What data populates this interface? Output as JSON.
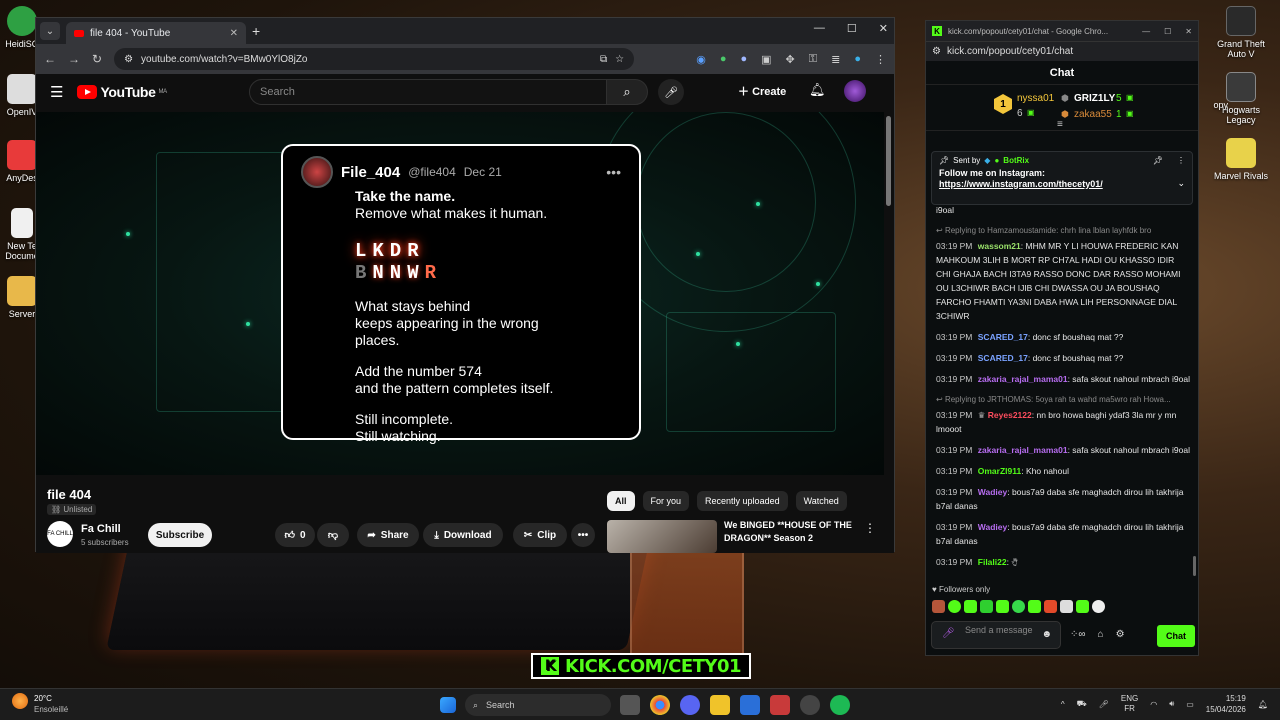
{
  "desktop": {
    "icons_left": [
      {
        "label": "HeidiSQ",
        "color": "#2ea043"
      },
      {
        "label": "OpenIV",
        "color": "#dddddd"
      },
      {
        "label": "AnyDes",
        "color": "#e83a3a"
      },
      {
        "label": "New Te Docume",
        "color": "#f0f0f0"
      },
      {
        "label": "Server",
        "color": "#e8b84a"
      }
    ],
    "icons_right": [
      {
        "label": "Grand Theft Auto V",
        "color": "#2a2a2a"
      },
      {
        "label": "Hogwarts Legacy",
        "color": "#3a3a3a"
      },
      {
        "label": "Marvel Rivals",
        "color": "#e8d24a"
      }
    ],
    "partial_icon_label": "opy"
  },
  "youtube_window": {
    "tab_title": "file 404 - YouTube",
    "url": "youtube.com/watch?v=BMw0YlO8jZo",
    "search_placeholder": "Search",
    "create_label": "Create",
    "logo_text": "YouTube",
    "logo_region": "MA",
    "tweet": {
      "name": "File_404",
      "handle": "@file404",
      "date": "Dec 21",
      "line1": "Take the name.",
      "line2": "Remove what makes it human.",
      "glitch1": "LKDR",
      "glitch2_dim": "B",
      "glitch2_mid": "NNW",
      "glitch2_red": "R",
      "p1": "What stays behind",
      "p2": "keeps appearing in the wrong",
      "p3": "places.",
      "p4": "Add the number 574",
      "p5": "and the pattern completes itself.",
      "p6": "Still incomplete.",
      "p7": "Still watching."
    },
    "video_title": "file 404",
    "visibility": "Unlisted",
    "channel": {
      "name": "Fa Chill",
      "subs": "5 subscribers",
      "avatar_text": "FA CHILL"
    },
    "subscribe_label": "Subscribe",
    "like_count": "0",
    "share_label": "Share",
    "download_label": "Download",
    "clip_label": "Clip",
    "chips": [
      "All",
      "For you",
      "Recently uploaded",
      "Watched"
    ],
    "recommendation_title": "We BINGED **HOUSE OF THE DRAGON** Season 2"
  },
  "kick_window": {
    "title": "kick.com/popout/cety01/chat - Google Chro...",
    "url": "kick.com/popout/cety01/chat",
    "header": "Chat",
    "top_gifters": [
      {
        "rank": "1",
        "name": "nyssa01",
        "count": "6",
        "color": "#f3c63b"
      },
      {
        "rank": "",
        "name": "GRIZ1LY",
        "count": "5",
        "color": "#e6e6e6"
      },
      {
        "rank": "",
        "name": "zakaa55",
        "count": "1",
        "color": "#e6e6e6"
      }
    ],
    "pinned": {
      "sent_by": "Sent by",
      "sender": "BotRix",
      "text": "Follow me on Instagram:",
      "link": "https://www.instagram.com/thecety01/"
    },
    "pinned_overflow": "i9oal",
    "messages": [
      {
        "reply": "Replying to Hamzamoustamide: chrh lina lblan layhfdk bro",
        "time": "03:19 PM",
        "user": "wassom21",
        "color": "#9be36b",
        "text": "MHM MR Y LI HOUWA FREDERIC KAN MAHKOUM 3LIH B MORT RP CH7AL HADI OU KHASSO IDIR CHI GHAJA BACH I3TA9 RASSO DONC DAR RASSO MOHAMI OU L3CHIWR BACH IJIB CHI DWASSA OU JA BOUSHAQ FARCHO FHAMTI YA3NI DABA HWA LIH PERSONNAGE DIAL 3CHIWR"
      },
      {
        "reply": "",
        "time": "03:19 PM",
        "user": "SCARED_17",
        "color": "#7aa2ff",
        "text": "donc sf boushaq mat ??"
      },
      {
        "reply": "",
        "time": "03:19 PM",
        "user": "SCARED_17",
        "color": "#7aa2ff",
        "text": "donc sf boushaq mat ??"
      },
      {
        "reply": "",
        "time": "03:19 PM",
        "user": "zakaria_rajal_mama01",
        "color": "#b76df0",
        "text": "safa skout nahoul mbrach i9oal"
      },
      {
        "reply": "Replying to JRTHOMAS: 5oya rah ta wahd ma5wro rah Howa...",
        "time": "03:19 PM",
        "user": "Reyes2122",
        "color": "#ff4d5e",
        "text": "nn bro howa baghi ydaf3 3la mr y mn lmooot"
      },
      {
        "reply": "",
        "time": "03:19 PM",
        "user": "zakaria_rajal_mama01",
        "color": "#b76df0",
        "text": "safa skout nahoul mbrach i9oal"
      },
      {
        "reply": "",
        "time": "03:19 PM",
        "user": "OmarZl911",
        "color": "#53fc18",
        "text": "Kho nahoul"
      },
      {
        "reply": "",
        "time": "03:19 PM",
        "user": "Wadiey",
        "color": "#b76df0",
        "text": "bous7a9 daba sfe maghadch dirou lih takhrija b7al danas"
      },
      {
        "reply": "",
        "time": "03:19 PM",
        "user": "Wadiey",
        "color": "#b76df0",
        "text": "bous7a9 daba sfe maghadch dirou lih takhrija b7al danas"
      },
      {
        "reply": "",
        "time": "03:19 PM",
        "user": "Filali22",
        "color": "#53fc18",
        "text": ""
      }
    ],
    "followers_only": "Followers only",
    "input_placeholder": "Send a message",
    "chat_button": "Chat",
    "accent": "#53fc18"
  },
  "overlay_banner": "KICK.COM/CETY01",
  "taskbar": {
    "temp": "20°C",
    "weather": "Ensoleillé",
    "search": "Search",
    "lang1": "ENG",
    "lang2": "FR",
    "time": "15:19",
    "date": "15/04/2026"
  }
}
